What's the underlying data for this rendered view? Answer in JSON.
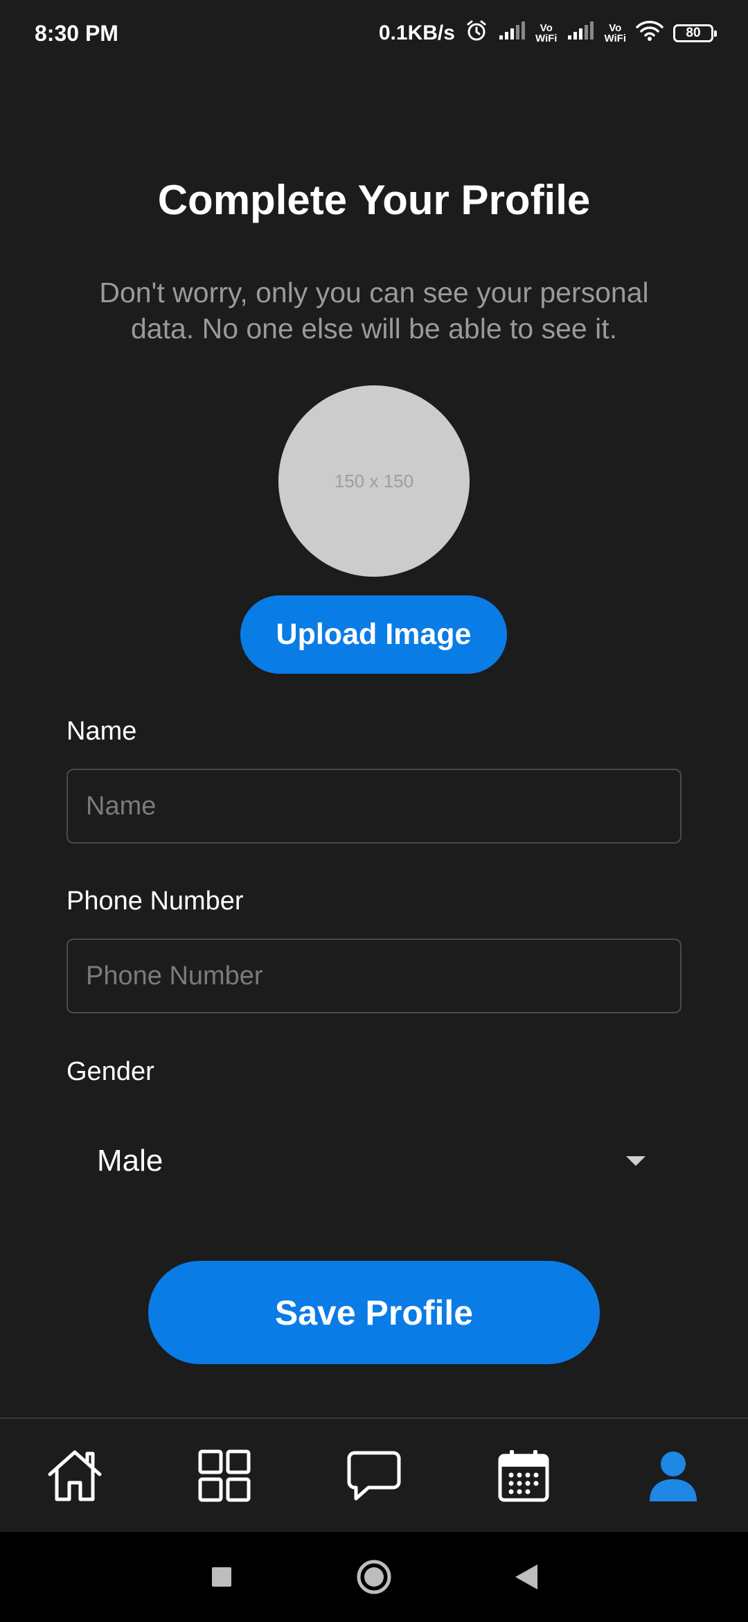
{
  "status_bar": {
    "time": "8:30 PM",
    "network_speed": "0.1KB/s",
    "vowifi_label_top": "Vo",
    "vowifi_label_bottom": "WiFi",
    "battery": "80",
    "icons": [
      "alarm-icon",
      "signal-icon",
      "vowifi-icon",
      "signal-icon",
      "vowifi-icon",
      "wifi-icon",
      "battery-icon"
    ]
  },
  "header": {
    "title": "Complete Your Profile",
    "subtitle": "Don't worry, only you can see your personal data. No one else will be able to see it."
  },
  "avatar": {
    "placeholder_text": "150 x 150"
  },
  "upload": {
    "label": "Upload Image"
  },
  "form": {
    "name": {
      "label": "Name",
      "value": "",
      "placeholder": "Name"
    },
    "phone": {
      "label": "Phone Number",
      "value": "",
      "placeholder": "Phone Number"
    },
    "gender": {
      "label": "Gender",
      "selected": "Male"
    }
  },
  "save": {
    "label": "Save Profile"
  },
  "bottom_nav": {
    "items": [
      {
        "icon": "home-icon",
        "active": false
      },
      {
        "icon": "grid-icon",
        "active": false
      },
      {
        "icon": "chat-icon",
        "active": false
      },
      {
        "icon": "calendar-icon",
        "active": false
      },
      {
        "icon": "profile-icon",
        "active": true
      }
    ]
  },
  "colors": {
    "background": "#1c1c1d",
    "accent": "#0a7ce6",
    "active_nav": "#1e88e5",
    "subtitle": "#9a9a9a",
    "avatar_placeholder": "#cccccc"
  },
  "system_nav": {
    "icons": [
      "recents-icon",
      "home-circle-icon",
      "back-icon"
    ]
  }
}
